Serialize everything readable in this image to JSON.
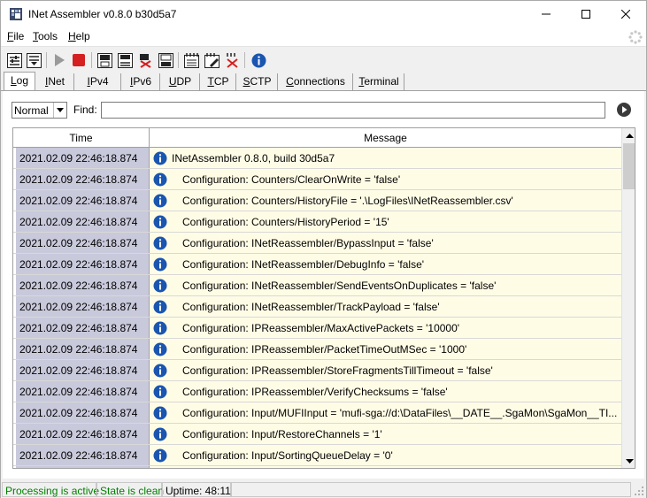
{
  "window": {
    "title": "INet Assembler v0.8.0 b30d5a7"
  },
  "menu": {
    "file": {
      "u": "F",
      "rest": "ile"
    },
    "tools": {
      "u": "T",
      "rest": "ools"
    },
    "help": {
      "u": "H",
      "rest": "elp"
    }
  },
  "toolbar": {
    "icons": [
      "settings-icon",
      "save-settings-icon",
      "play-icon",
      "stop-icon",
      "save-log-icon",
      "save-log-as-icon",
      "clear-log-icon",
      "export-icon",
      "notes-icon",
      "notes-edit-icon",
      "notes-clear-icon",
      "about-icon"
    ],
    "colors": {
      "stop": "#d42020",
      "info": "#1a55b0",
      "delete": "#d42020"
    }
  },
  "tabs": [
    {
      "u": "L",
      "rest": "og"
    },
    {
      "u": "I",
      "rest": "Net"
    },
    {
      "u": "I",
      "rest": "Pv4"
    },
    {
      "u": "I",
      "rest": "Pv6"
    },
    {
      "u": "U",
      "rest": "DP"
    },
    {
      "u": "T",
      "rest": "CP"
    },
    {
      "u": "S",
      "rest": "CTP"
    },
    {
      "u": "C",
      "rest": "onnections"
    },
    {
      "u": "T",
      "rest": "erminal"
    }
  ],
  "filter": {
    "level": "Normal",
    "find_label": "Find:",
    "find_value": ""
  },
  "grid": {
    "col_time": "Time",
    "col_message": "Message",
    "rows": [
      {
        "time": "2021.02.09 22:46:18.874",
        "message": "INetAssembler 0.8.0, build 30d5a7",
        "indent": false
      },
      {
        "time": "2021.02.09 22:46:18.874",
        "message": "Configuration: Counters/ClearOnWrite = 'false'",
        "indent": true
      },
      {
        "time": "2021.02.09 22:46:18.874",
        "message": "Configuration: Counters/HistoryFile = '.\\LogFiles\\INetReassembler.csv'",
        "indent": true
      },
      {
        "time": "2021.02.09 22:46:18.874",
        "message": "Configuration: Counters/HistoryPeriod = '15'",
        "indent": true
      },
      {
        "time": "2021.02.09 22:46:18.874",
        "message": "Configuration: INetReassembler/BypassInput = 'false'",
        "indent": true
      },
      {
        "time": "2021.02.09 22:46:18.874",
        "message": "Configuration: INetReassembler/DebugInfo = 'false'",
        "indent": true
      },
      {
        "time": "2021.02.09 22:46:18.874",
        "message": "Configuration: INetReassembler/SendEventsOnDuplicates = 'false'",
        "indent": true
      },
      {
        "time": "2021.02.09 22:46:18.874",
        "message": "Configuration: INetReassembler/TrackPayload = 'false'",
        "indent": true
      },
      {
        "time": "2021.02.09 22:46:18.874",
        "message": "Configuration: IPReassembler/MaxActivePackets = '10000'",
        "indent": true
      },
      {
        "time": "2021.02.09 22:46:18.874",
        "message": "Configuration: IPReassembler/PacketTimeOutMSec = '1000'",
        "indent": true
      },
      {
        "time": "2021.02.09 22:46:18.874",
        "message": "Configuration: IPReassembler/StoreFragmentsTillTimeout = 'false'",
        "indent": true
      },
      {
        "time": "2021.02.09 22:46:18.874",
        "message": "Configuration: IPReassembler/VerifyChecksums = 'false'",
        "indent": true
      },
      {
        "time": "2021.02.09 22:46:18.874",
        "message": "Configuration: Input/MUFIInput = 'mufi-sga://d:\\DataFiles\\__DATE__.SgaMon\\SgaMon__TI...",
        "indent": true
      },
      {
        "time": "2021.02.09 22:46:18.874",
        "message": "Configuration: Input/RestoreChannels = '1'",
        "indent": true
      },
      {
        "time": "2021.02.09 22:46:18.874",
        "message": "Configuration: Input/SortingQueueDelay = '0'",
        "indent": true
      },
      {
        "time": "",
        "message": "",
        "indent": true
      }
    ]
  },
  "status": {
    "processing": "Processing is active",
    "state": "State is clean",
    "uptime": "Uptime: 48:11",
    "status_color": "#008000"
  }
}
